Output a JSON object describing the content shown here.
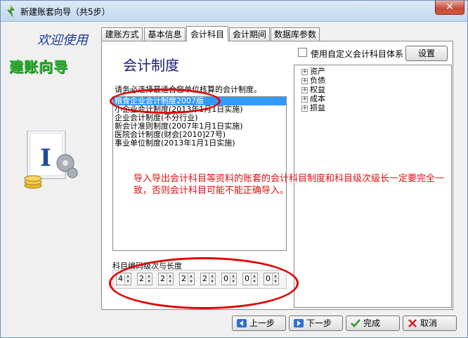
{
  "window": {
    "title": "新建账套向导（共5步）",
    "close_label": "✕"
  },
  "left_panel": {
    "welcome": "欢迎使用",
    "guide": "建账向导"
  },
  "tabs": [
    {
      "label": "建账方式"
    },
    {
      "label": "基本信息"
    },
    {
      "label": "会计科目"
    },
    {
      "label": "会计期间"
    },
    {
      "label": "数据库参数"
    }
  ],
  "content": {
    "heading": "会计制度",
    "custom_subject_label": "使用自定义会计科目体系",
    "setup_button": "设置",
    "instruction": "请务必选择最适合您单位核算的会计制度。",
    "systems": [
      "粮食企业会计制度2007版",
      "小企业会计制度(2013年1月1日实施)",
      "企业会计制度(不分行业)",
      "新会计准则制度(2007年1月1日实施)",
      "医院会计制度(财会[2010]27号)",
      "事业单位制度(2013年1月1日实施)"
    ],
    "selected_index": 0,
    "subject_tree": [
      "资产",
      "负债",
      "权益",
      "成本",
      "损益"
    ],
    "note": "导入导出会计科目等资料的账套的会计科目制度和科目级次级长一定要完全一致，否则会计科目可能不能正确导入。",
    "code_label": "科目编码级次与长度",
    "code_levels": [
      "4",
      "2",
      "2",
      "2",
      "2",
      "0",
      "0",
      "0"
    ]
  },
  "buttons": {
    "prev": "上一步",
    "next": "下一步",
    "finish": "完成",
    "cancel": "取消"
  },
  "colors": {
    "annotation": "#e00000",
    "welcome": "#1a3a9a",
    "guide": "#2fb233",
    "selection": "#3399ff"
  }
}
